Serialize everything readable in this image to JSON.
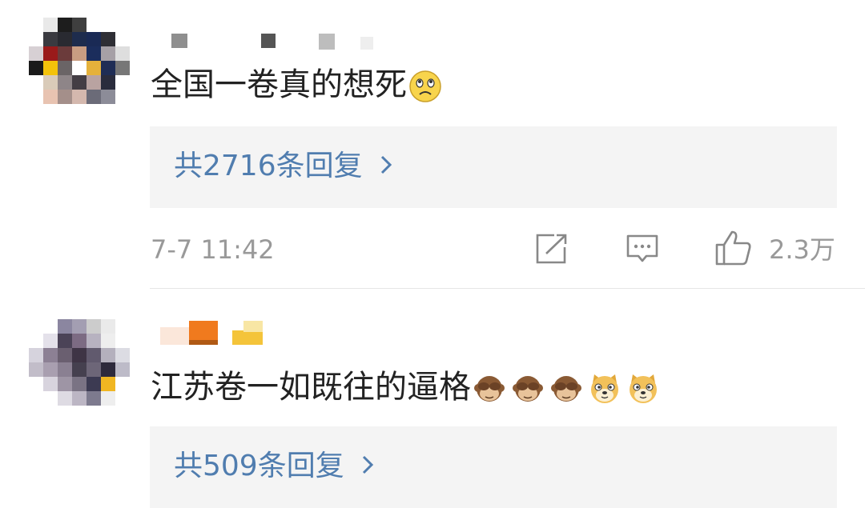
{
  "comments": [
    {
      "text": "全国一卷真的想死",
      "emojis": [
        "sad-face-icon"
      ],
      "replies_label": "共2716条回复",
      "timestamp": "7-7 11:42",
      "like_count": "2.3万"
    },
    {
      "text": "江苏卷一如既往的逼格",
      "emojis": [
        "see-no-evil-monkey-icon",
        "see-no-evil-monkey-icon",
        "see-no-evil-monkey-icon",
        "doge-icon",
        "doge-icon"
      ],
      "replies_label": "共509条回复"
    }
  ],
  "icons": {
    "share": "edit-share-icon",
    "comment": "comment-icon",
    "like": "thumbs-up-icon",
    "chevron": "chevron-right-icon"
  },
  "colors": {
    "link": "#507daf",
    "text": "#222222",
    "meta": "#999999",
    "reply_bg": "#f4f4f4"
  }
}
